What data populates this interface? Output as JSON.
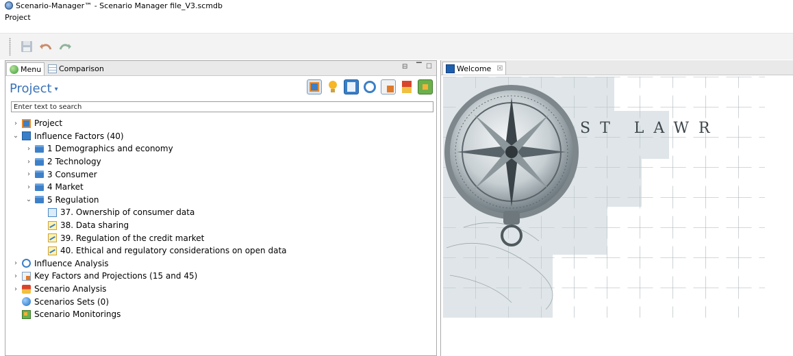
{
  "window": {
    "title": "Scenario-Manager™ - Scenario Manager file_V3.scmdb"
  },
  "menubar": {
    "items": [
      {
        "label": "Project"
      }
    ]
  },
  "toolbar": {
    "buttons": [
      {
        "name": "save-button",
        "icon": "save-icon"
      },
      {
        "name": "undo-button",
        "icon": "undo-icon"
      },
      {
        "name": "redo-button",
        "icon": "redo-icon"
      }
    ]
  },
  "left_panel": {
    "tabs": [
      {
        "label": "Menu",
        "icon": "globe-icon",
        "active": true
      },
      {
        "label": "Comparison",
        "icon": "table-icon",
        "active": false
      }
    ],
    "header": {
      "title": "Project",
      "caret": "▾"
    },
    "search": {
      "placeholder": "Enter text to search"
    },
    "tree": [
      {
        "label": "Project",
        "level": 0,
        "expander": "›",
        "icon": "project-icon"
      },
      {
        "label": "Influence Factors (40)",
        "level": 0,
        "expander": "⌄",
        "icon": "book-icon"
      },
      {
        "label": "1 Demographics and economy",
        "level": 1,
        "expander": "›",
        "icon": "folder-icon"
      },
      {
        "label": "2 Technology",
        "level": 1,
        "expander": "›",
        "icon": "folder-icon"
      },
      {
        "label": "3 Consumer",
        "level": 1,
        "expander": "›",
        "icon": "folder-icon"
      },
      {
        "label": "4 Market",
        "level": 1,
        "expander": "›",
        "icon": "folder-icon"
      },
      {
        "label": "5 Regulation",
        "level": 1,
        "expander": "⌄",
        "icon": "folder-icon"
      },
      {
        "label": "37. Ownership of consumer data",
        "level": 2,
        "expander": "",
        "icon": "page-icon"
      },
      {
        "label": "38. Data sharing",
        "level": 2,
        "expander": "",
        "icon": "chart-icon"
      },
      {
        "label": "39. Regulation of the credit market",
        "level": 2,
        "expander": "",
        "icon": "chart-icon"
      },
      {
        "label": "40. Ethical and regulatory considerations on open data",
        "level": 2,
        "expander": "",
        "icon": "chart-icon"
      },
      {
        "label": "Influence Analysis",
        "level": 0,
        "expander": "›",
        "icon": "analysis-icon"
      },
      {
        "label": "Key Factors and Projections (15 and 45)",
        "level": 0,
        "expander": "›",
        "icon": "keyfactors-icon"
      },
      {
        "label": "Scenario Analysis",
        "level": 0,
        "expander": "›",
        "icon": "scenario-analysis-icon"
      },
      {
        "label": "Scenarios Sets (0)",
        "level": 0,
        "expander": "",
        "icon": "globe-icon"
      },
      {
        "label": "Scenario Monitorings",
        "level": 0,
        "expander": "",
        "icon": "monitoring-icon"
      }
    ]
  },
  "right_panel": {
    "tab": {
      "label": "Welcome",
      "close": "☒",
      "icon": "monitor-icon"
    },
    "image": {
      "caption_text": "ST LAWR",
      "icon": "compass-puzzle-image"
    }
  },
  "colors": {
    "accent": "#3a73b8",
    "toolbar_bg": "#f3f3f3",
    "tab_bg": "#e9e9e9"
  }
}
